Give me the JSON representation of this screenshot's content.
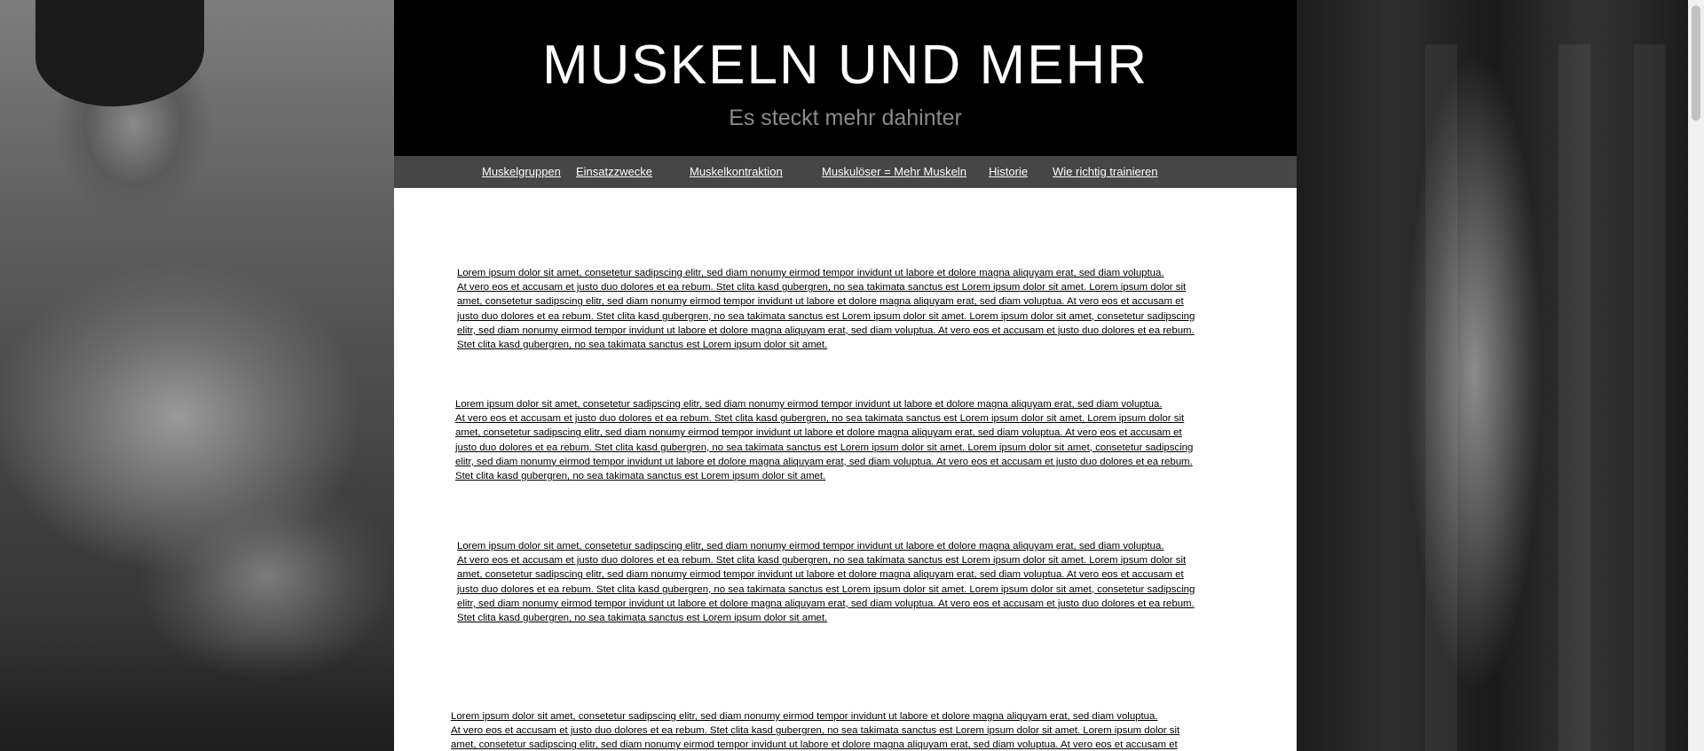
{
  "site": {
    "title": "MUSKELN UND MEHR",
    "subtitle": "Es steckt mehr dahinter"
  },
  "nav": {
    "items": [
      {
        "label": "Muskelgruppen"
      },
      {
        "label": "Einsatzzwecke"
      },
      {
        "label": "Muskelkontraktion"
      },
      {
        "label": "Muskulöser = Mehr Muskeln"
      },
      {
        "label": "Historie"
      },
      {
        "label": "Wie richtig trainieren"
      }
    ]
  },
  "content": {
    "paragraphs": [
      {
        "lines": [
          "Lorem ipsum dolor sit amet, consetetur sadipscing elitr, sed diam nonumy eirmod tempor invidunt ut labore et dolore magna aliquyam erat, sed diam voluptua.",
          "At vero eos et accusam et justo duo dolores et ea rebum. Stet clita kasd gubergren, no sea takimata sanctus est Lorem ipsum dolor sit amet. Lorem ipsum dolor sit",
          "amet, consetetur sadipscing elitr, sed diam nonumy eirmod tempor invidunt ut labore et dolore magna aliquyam erat, sed diam voluptua. At vero eos et accusam et",
          "justo duo dolores et ea rebum. Stet clita kasd gubergren, no sea takimata sanctus est Lorem ipsum dolor sit amet. Lorem ipsum dolor sit amet, consetetur sadipscing",
          "elitr, sed diam nonumy eirmod tempor invidunt ut labore et dolore magna aliquyam erat, sed diam voluptua. At vero eos et accusam et justo duo dolores et ea rebum.",
          " Stet clita kasd gubergren, no sea takimata sanctus est Lorem ipsum dolor sit amet."
        ]
      },
      {
        "lines": [
          "Lorem ipsum dolor sit amet, consetetur sadipscing elitr, sed diam nonumy eirmod tempor invidunt ut labore et dolore magna aliquyam erat, sed diam voluptua.",
          "At vero eos et accusam et justo duo dolores et ea rebum. Stet clita kasd gubergren, no sea takimata sanctus est Lorem ipsum dolor sit amet. Lorem ipsum dolor sit",
          "amet, consetetur sadipscing elitr, sed diam nonumy eirmod tempor invidunt ut labore et dolore magna aliquyam erat, sed diam voluptua. At vero eos et accusam et",
          "justo duo dolores et ea rebum. Stet clita kasd gubergren, no sea takimata sanctus est Lorem ipsum dolor sit amet. Lorem ipsum dolor sit amet, consetetur sadipscing",
          "elitr, sed diam nonumy eirmod tempor invidunt ut labore et dolore magna aliquyam erat, sed diam voluptua. At vero eos et accusam et justo duo dolores et ea rebum.",
          " Stet clita kasd gubergren, no sea takimata sanctus est Lorem ipsum dolor sit amet."
        ]
      },
      {
        "lines": [
          "Lorem ipsum dolor sit amet, consetetur sadipscing elitr, sed diam nonumy eirmod tempor invidunt ut labore et dolore magna aliquyam erat, sed diam voluptua.",
          "At vero eos et accusam et justo duo dolores et ea rebum. Stet clita kasd gubergren, no sea takimata sanctus est Lorem ipsum dolor sit amet. Lorem ipsum dolor sit",
          "amet, consetetur sadipscing elitr, sed diam nonumy eirmod tempor invidunt ut labore et dolore magna aliquyam erat, sed diam voluptua. At vero eos et accusam et",
          "justo duo dolores et ea rebum. Stet clita kasd gubergren, no sea takimata sanctus est Lorem ipsum dolor sit amet. Lorem ipsum dolor sit amet, consetetur sadipscing",
          "elitr, sed diam nonumy eirmod tempor invidunt ut labore et dolore magna aliquyam erat, sed diam voluptua. At vero eos et accusam et justo duo dolores et ea rebum.",
          " Stet clita kasd gubergren, no sea takimata sanctus est Lorem ipsum dolor sit amet."
        ]
      },
      {
        "lines": [
          "Lorem ipsum dolor sit amet, consetetur sadipscing elitr, sed diam nonumy eirmod tempor invidunt ut labore et dolore magna aliquyam erat, sed diam voluptua.",
          "At vero eos et accusam et justo duo dolores et ea rebum. Stet clita kasd gubergren, no sea takimata sanctus est Lorem ipsum dolor sit amet. Lorem ipsum dolor sit",
          "amet, consetetur sadipscing elitr, sed diam nonumy eirmod tempor invidunt ut labore et dolore magna aliquyam erat, sed diam voluptua. At vero eos et accusam et"
        ]
      }
    ]
  },
  "colors": {
    "header_bg": "#000000",
    "nav_bg": "#464646",
    "title": "#ffffff",
    "subtitle": "#8a8a8a",
    "content_bg": "#ffffff"
  }
}
